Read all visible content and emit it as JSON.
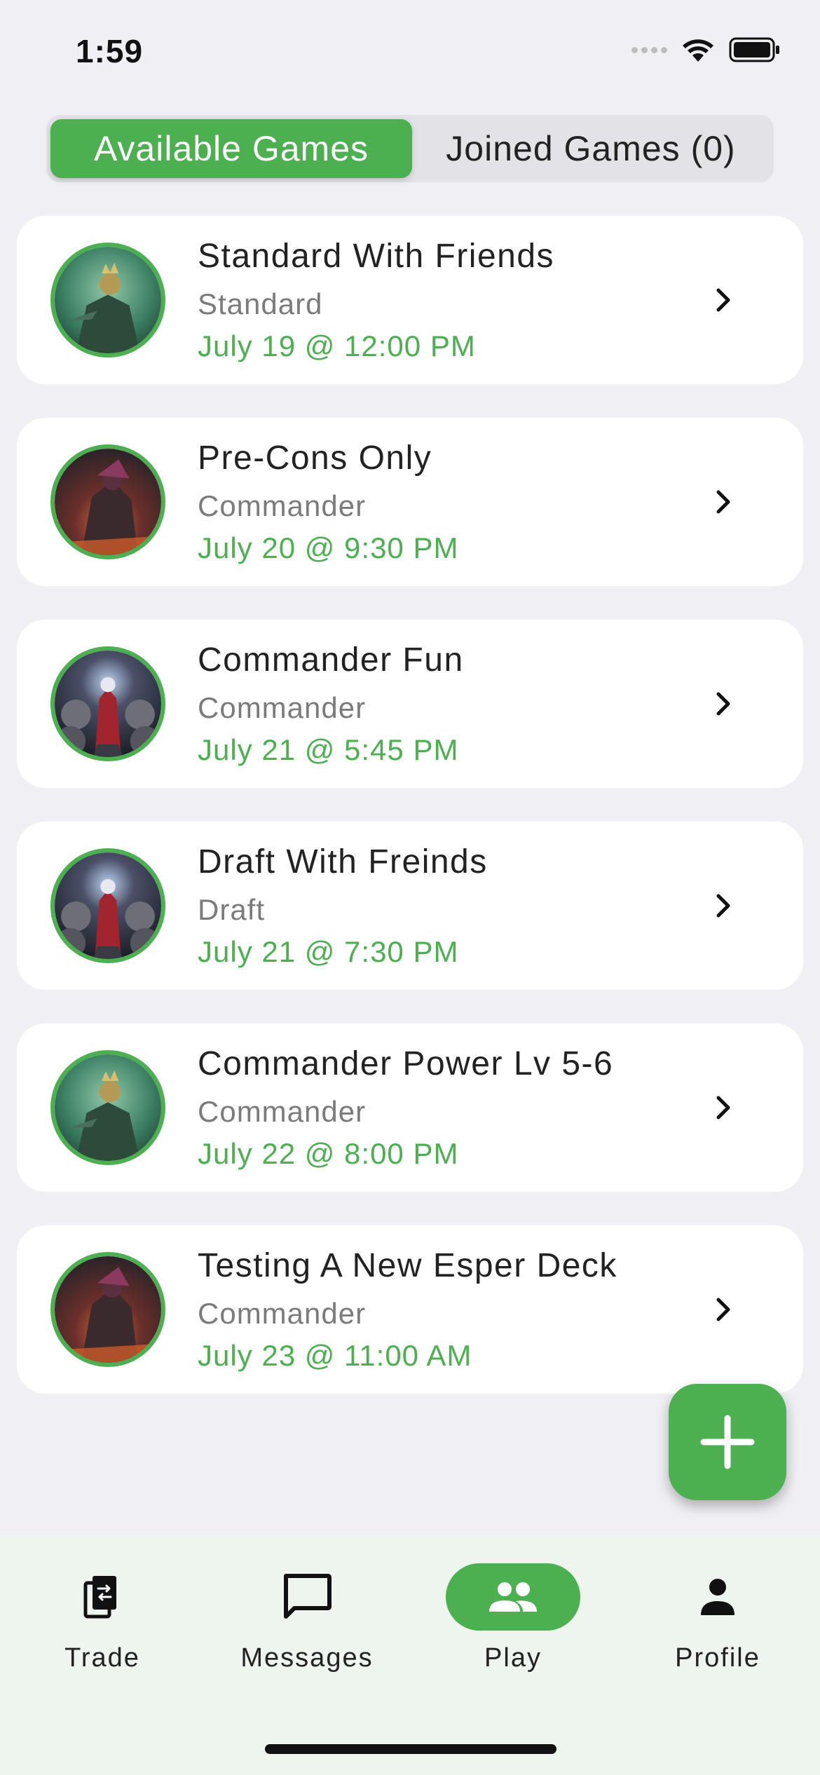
{
  "status_bar": {
    "time": "1:59"
  },
  "segments": [
    {
      "label": "Available Games",
      "active": true
    },
    {
      "label": "Joined Games (0)",
      "active": false
    }
  ],
  "games": [
    {
      "title": "Standard With Friends",
      "format": "Standard",
      "date": "July 19 @ 12:00 PM",
      "avatar": "goblin-king-art"
    },
    {
      "title": "Pre-Cons Only",
      "format": "Commander",
      "date": "July 20 @ 9:30 PM",
      "avatar": "dark-warrior-art"
    },
    {
      "title": "Commander Fun",
      "format": "Commander",
      "date": "July 21 @ 5:45 PM",
      "avatar": "throne-sorcerer-art"
    },
    {
      "title": "Draft With Freinds",
      "format": "Draft",
      "date": "July 21 @ 7:30 PM",
      "avatar": "throne-sorcerer-art"
    },
    {
      "title": "Commander Power Lv 5-6",
      "format": "Commander",
      "date": "July 22 @ 8:00 PM",
      "avatar": "goblin-king-art"
    },
    {
      "title": "Testing A New Esper Deck",
      "format": "Commander",
      "date": "July 23 @ 11:00 AM",
      "avatar": "dark-warrior-art"
    }
  ],
  "fab": {
    "icon": "plus-icon"
  },
  "nav": [
    {
      "label": "Trade",
      "icon": "trade-cards-icon",
      "active": false
    },
    {
      "label": "Messages",
      "icon": "chat-bubble-icon",
      "active": false
    },
    {
      "label": "Play",
      "icon": "people-icon",
      "active": true
    },
    {
      "label": "Profile",
      "icon": "person-icon",
      "active": false
    }
  ],
  "colors": {
    "accent": "#4caf50",
    "background": "#efeff4",
    "nav_background": "#eef5ee"
  }
}
